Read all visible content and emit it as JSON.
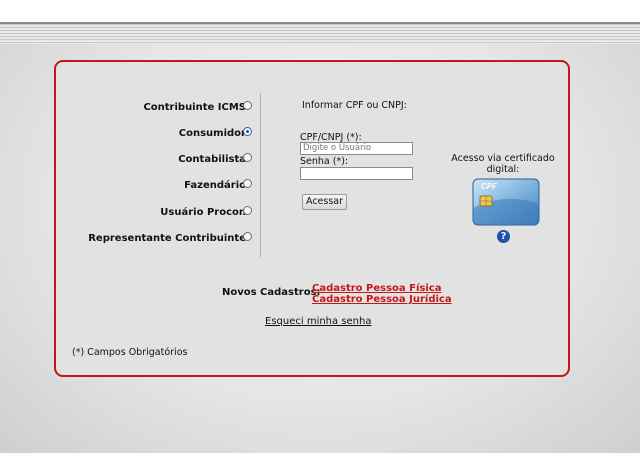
{
  "profiles": [
    {
      "label": "Contribuinte ICMS",
      "selected": false
    },
    {
      "label": "Consumidor",
      "selected": true
    },
    {
      "label": "Contabilista",
      "selected": false
    },
    {
      "label": "Fazendário",
      "selected": false
    },
    {
      "label": "Usuário Procon",
      "selected": false
    },
    {
      "label": "Representante Contribuinte",
      "selected": false
    }
  ],
  "login": {
    "heading": "Informar CPF ou CNPJ:",
    "cpf_label": "CPF/CNPJ (*):",
    "cpf_placeholder": "Digite o Usuário",
    "cpf_value": "",
    "password_label": "Senha (*):",
    "password_value": "",
    "submit_label": "Acessar"
  },
  "certificate": {
    "text": "Acesso via certificado digital:",
    "card_text": "CPF",
    "help_icon": "help-icon"
  },
  "registration": {
    "label": "Novos Cadastros:",
    "link_pf": "Cadastro Pessoa Física",
    "link_pj": "Cadastro Pessoa Jurídica"
  },
  "forgot_password": "Esqueci minha senha",
  "required_note": "(*) Campos Obrigatórios",
  "colors": {
    "accent": "#c41818",
    "panel": "#e2e2e2",
    "link": "#c41818"
  }
}
